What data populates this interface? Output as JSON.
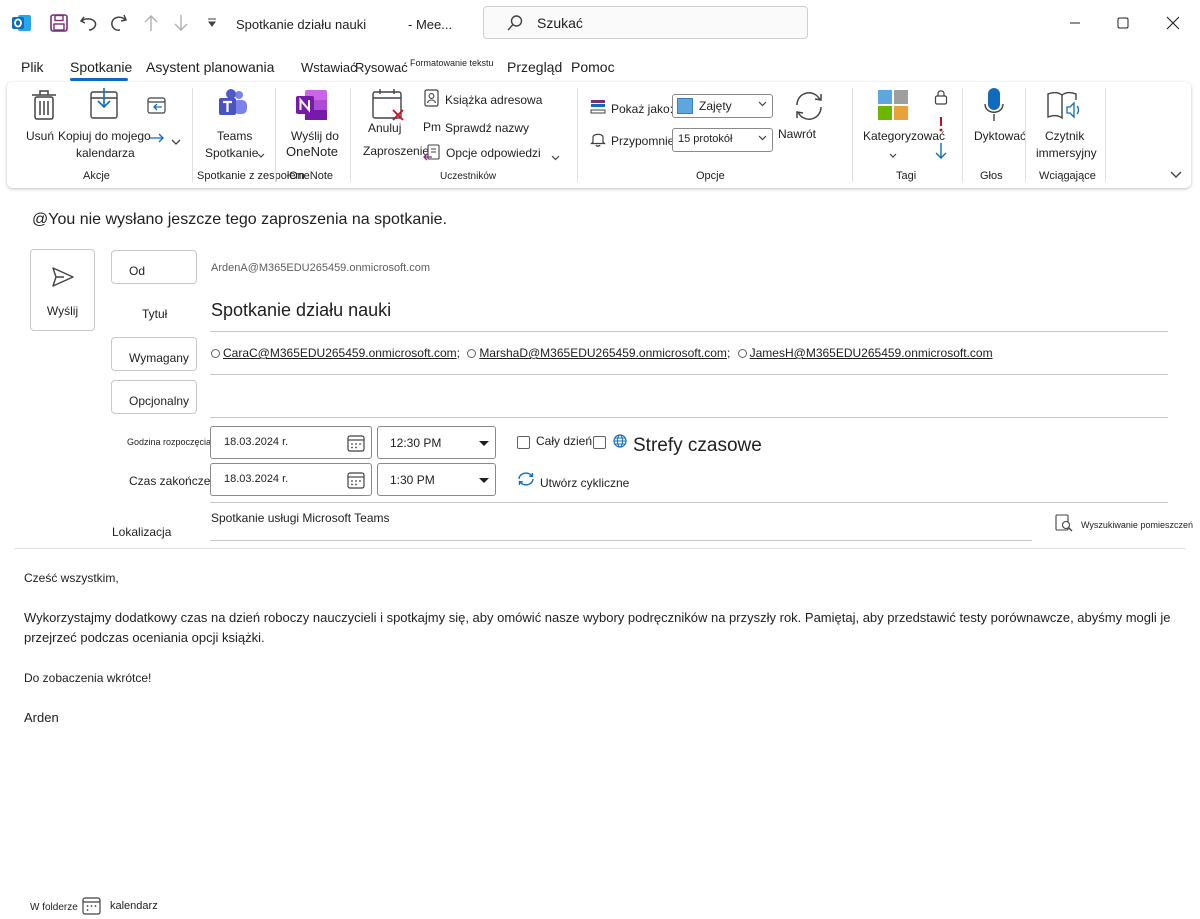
{
  "window": {
    "title": "Spotkanie działu nauki",
    "title_suffix": "- Mee...",
    "search_placeholder": "Szukać"
  },
  "tabs": [
    {
      "label": "Plik"
    },
    {
      "label": "Spotkanie"
    },
    {
      "label": "Asystent planowania"
    },
    {
      "label": "Wstawiać"
    },
    {
      "label": "Rysować"
    },
    {
      "label": "Formatowanie tekstu"
    },
    {
      "label": "Przegląd"
    },
    {
      "label": "Pomoc"
    }
  ],
  "ribbon": {
    "delete": "Usuń",
    "copy_line1": "Kopiuj do mojego",
    "copy_line2": "kalendarza",
    "actions_group": "Akcje",
    "teams_line1": "Teams",
    "teams_line2": "Spotkanie",
    "teams_group": "Spotkanie z zespołem",
    "onenote_line1": "Wyślij do",
    "onenote_line2": "OneNote",
    "onenote_group": "OneNote",
    "cancel_line1": "Anuluj",
    "cancel_line2": "Zaproszenie",
    "address_book": "Książka adresowa",
    "check_names": "Sprawdź nazwy",
    "response_options": "Opcje odpowiedzi",
    "attendees_group": "Uczestników",
    "show_as_label": "Pokaż jako:",
    "show_as_value": "Zajęty",
    "reminder_label": "Przypomnienie:",
    "reminder_value": "15 protokół",
    "recurrence": "Nawrót",
    "options_group": "Opcje",
    "categorize": "Kategoryzować",
    "tags_group": "Tagi",
    "dictate": "Dyktować",
    "voice_group": "Głos",
    "reader_line1": "Czytnik",
    "reader_line2": "immersyjny",
    "immersive_group": "Wciągające"
  },
  "form": {
    "info": "@You nie wysłano jeszcze tego zaproszenia na spotkanie.",
    "send_label": "Wyślij",
    "from_label": "Od",
    "from_value": "ArdenA@M365EDU265459.onmicrosoft.com",
    "title_label": "Tytuł",
    "title_value": "Spotkanie działu nauki",
    "required_label": "Wymagany",
    "required": [
      "CaraC@M365EDU265459.onmicrosoft.com",
      "MarshaD@M365EDU265459.onmicrosoft.com",
      "JamesH@M365EDU265459.onmicrosoft.com"
    ],
    "optional_label": "Opcjonalny",
    "start_label": "Godzina rozpoczęcia",
    "start_date": "18.03.2024 r.",
    "start_time": "12:30 PM",
    "end_label": "Czas zakończenia",
    "end_date": "18.03.2024 r.",
    "end_time": "1:30 PM",
    "all_day": "Cały dzień",
    "time_zones": "Strefy czasowe",
    "recurring": "Utwórz cykliczne",
    "location_label": "Lokalizacja",
    "location_value": "Spotkanie usługi Microsoft Teams",
    "room_search": "Wyszukiwanie pomieszczeń"
  },
  "body": {
    "greeting": "Cześć wszystkim,",
    "para1": "Wykorzystajmy dodatkowy czas na dzień roboczy nauczycieli i spotkajmy się, aby omówić nasze wybory podręczników na przyszły rok. Pamiętaj, aby przedstawić testy porównawcze, abyśmy mogli je przejrzeć podczas oceniania opcji książki.",
    "closing": "Do zobaczenia wkrótce!",
    "signature": "Arden"
  },
  "footer": {
    "folder_label": "W folderze",
    "folder_value": "kalendarz"
  },
  "colors": {
    "accent": "#0f6cbd",
    "outlook_blue": "#0f6cbd",
    "save_purple": "#7a2d7b",
    "teams_purple": "#5059c9",
    "onenote_purple": "#7719aa",
    "flag_red": "#c50f1f"
  }
}
